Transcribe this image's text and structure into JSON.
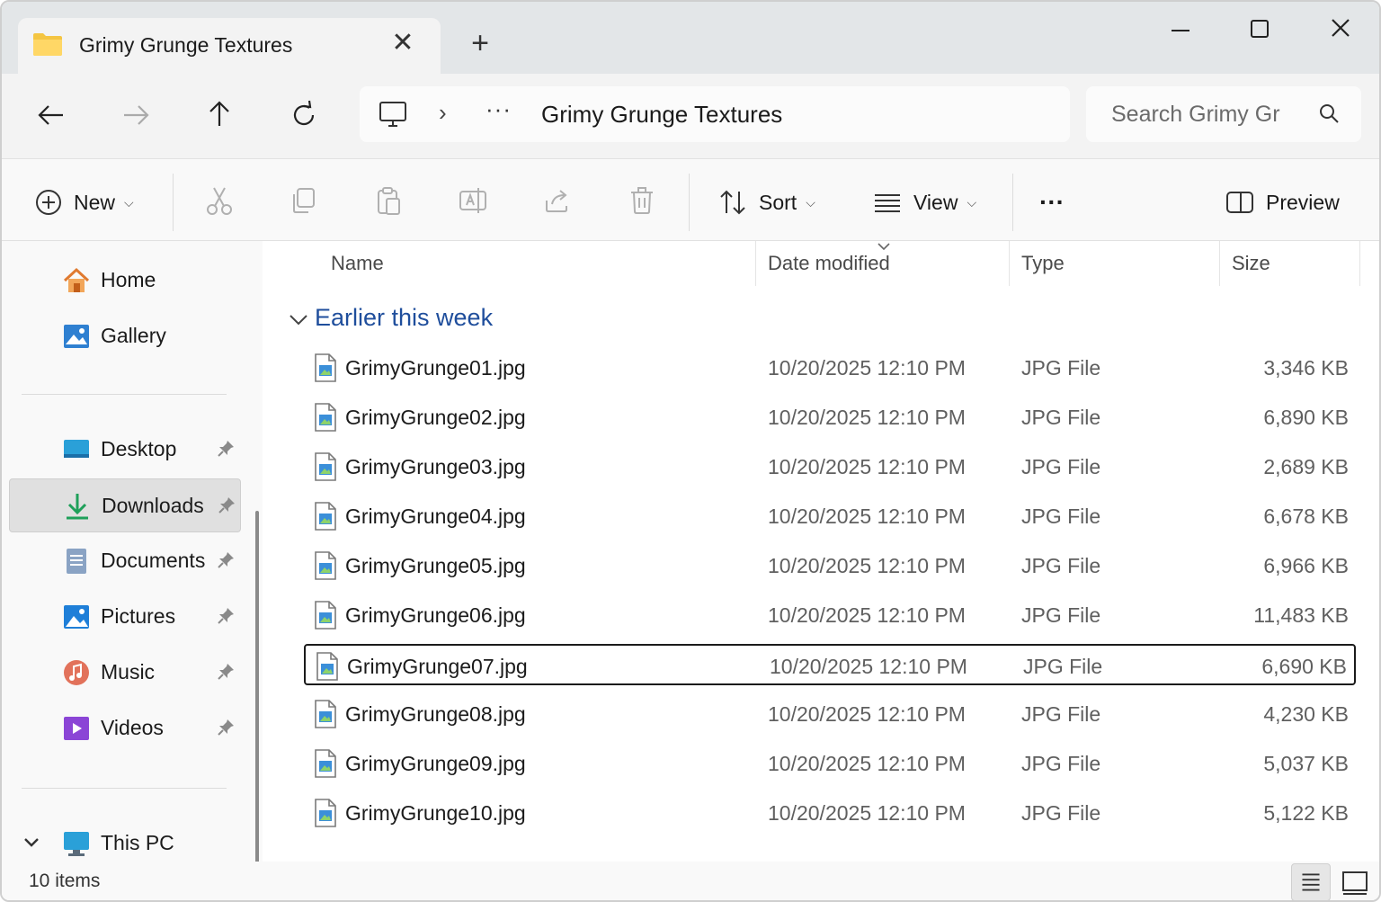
{
  "window": {
    "tab_title": "Grimy Grunge Textures",
    "tab_close": "✕",
    "new_tab": "+"
  },
  "nav": {
    "path_sep": "›",
    "path_overflow": "···",
    "current_path": "Grimy Grunge Textures",
    "search_placeholder": "Search Grimy Gr"
  },
  "commands": {
    "new_label": "New",
    "sort_label": "Sort",
    "view_label": "View",
    "more_label": "···",
    "preview_label": "Preview",
    "dropdown_chevron": "⌵"
  },
  "sidebar": {
    "items": [
      {
        "label": "Home",
        "icon": "home-icon"
      },
      {
        "label": "Gallery",
        "icon": "gallery-icon"
      },
      {
        "label": "Desktop",
        "icon": "desktop-icon",
        "pinned": true
      },
      {
        "label": "Downloads",
        "icon": "download-icon",
        "pinned": true,
        "selected": true
      },
      {
        "label": "Documents",
        "icon": "document-icon",
        "pinned": true
      },
      {
        "label": "Pictures",
        "icon": "pictures-icon",
        "pinned": true
      },
      {
        "label": "Music",
        "icon": "music-icon",
        "pinned": true
      },
      {
        "label": "Videos",
        "icon": "videos-icon",
        "pinned": true
      },
      {
        "label": "This PC",
        "icon": "this-pc-icon"
      }
    ]
  },
  "columns": {
    "name": "Name",
    "date": "Date modified",
    "type": "Type",
    "size": "Size"
  },
  "group": {
    "title": "Earlier this week"
  },
  "files": [
    {
      "name": "GrimyGrunge01.jpg",
      "date": "10/20/2025 12:10 PM",
      "type": "JPG File",
      "size": "3,346 KB"
    },
    {
      "name": "GrimyGrunge02.jpg",
      "date": "10/20/2025 12:10 PM",
      "type": "JPG File",
      "size": "6,890 KB"
    },
    {
      "name": "GrimyGrunge03.jpg",
      "date": "10/20/2025 12:10 PM",
      "type": "JPG File",
      "size": "2,689 KB"
    },
    {
      "name": "GrimyGrunge04.jpg",
      "date": "10/20/2025 12:10 PM",
      "type": "JPG File",
      "size": "6,678 KB"
    },
    {
      "name": "GrimyGrunge05.jpg",
      "date": "10/20/2025 12:10 PM",
      "type": "JPG File",
      "size": "6,966 KB"
    },
    {
      "name": "GrimyGrunge06.jpg",
      "date": "10/20/2025 12:10 PM",
      "type": "JPG File",
      "size": "11,483 KB"
    },
    {
      "name": "GrimyGrunge07.jpg",
      "date": "10/20/2025 12:10 PM",
      "type": "JPG File",
      "size": "6,690 KB",
      "focused": true
    },
    {
      "name": "GrimyGrunge08.jpg",
      "date": "10/20/2025 12:10 PM",
      "type": "JPG File",
      "size": "4,230 KB"
    },
    {
      "name": "GrimyGrunge09.jpg",
      "date": "10/20/2025 12:10 PM",
      "type": "JPG File",
      "size": "5,037 KB"
    },
    {
      "name": "GrimyGrunge10.jpg",
      "date": "10/20/2025 12:10 PM",
      "type": "JPG File",
      "size": "5,122 KB"
    }
  ],
  "status": {
    "item_count": "10 items"
  },
  "colors": {
    "accent": "#1f4e9c",
    "folder": "#f4c542",
    "selection": "#e0e0e0"
  }
}
